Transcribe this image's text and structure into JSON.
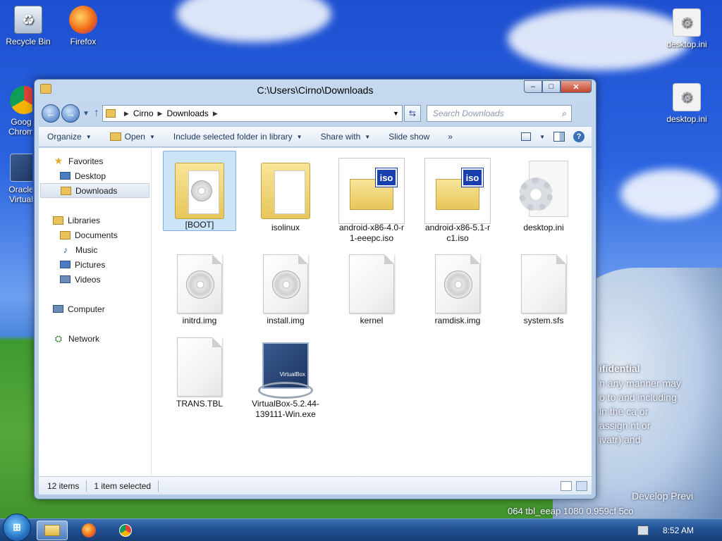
{
  "desktop": {
    "icons_left": [
      {
        "label": "Recycle Bin",
        "icon": "recycle-bin-icon"
      },
      {
        "label": "Firefox",
        "icon": "firefox-icon"
      },
      {
        "label": "Goog Chrom",
        "icon": "chrome-icon"
      },
      {
        "label": "Oracle Virtual",
        "icon": "virtualbox-icon"
      }
    ],
    "icons_right": [
      {
        "label": "desktop.ini",
        "icon": "settings-file-icon"
      },
      {
        "label": "desktop.ini",
        "icon": "settings-file-icon"
      }
    ],
    "wallpaper_text": [
      "ifidential",
      "n any manner may",
      "o to and including",
      "in the ca    or",
      "assign   nt or",
      "    ivatr) and",
      "Develop   Previ",
      "064 tbl_eeap 1080    0.959cf   5co"
    ]
  },
  "window": {
    "title": "C:\\Users\\Cirno\\Downloads",
    "controls": {
      "minimize": "–",
      "maximize": "□",
      "close": "✕"
    },
    "breadcrumb": [
      "Cirno",
      "Downloads"
    ],
    "search_placeholder": "Search Downloads",
    "toolbar": {
      "organize": "Organize",
      "open": "Open",
      "include": "Include selected folder in library",
      "share": "Share with",
      "slideshow": "Slide show",
      "more": "»"
    },
    "nav": {
      "favorites": "Favorites",
      "desktop": "Desktop",
      "downloads": "Downloads",
      "libraries": "Libraries",
      "documents": "Documents",
      "music": "Music",
      "pictures": "Pictures",
      "videos": "Videos",
      "computer": "Computer",
      "network": "Network"
    },
    "files": [
      {
        "name": "[BOOT]",
        "type": "folder-disc",
        "selected": true
      },
      {
        "name": "isolinux",
        "type": "folder"
      },
      {
        "name": "android-x86-4.0-r1-eeepc.iso",
        "label_lines": [
          "android-x86-4.0-r",
          "1-eeepc.iso"
        ],
        "type": "iso"
      },
      {
        "name": "android-x86-5.1-rc1.iso",
        "label_lines": [
          "android-x86-5.1-r",
          "c1.iso"
        ],
        "type": "iso"
      },
      {
        "name": "desktop.ini",
        "type": "config"
      },
      {
        "name": "initrd.img",
        "type": "disc-image"
      },
      {
        "name": "install.img",
        "type": "disc-image"
      },
      {
        "name": "kernel",
        "type": "blank"
      },
      {
        "name": "ramdisk.img",
        "type": "disc-image"
      },
      {
        "name": "system.sfs",
        "type": "blank"
      },
      {
        "name": "TRANS.TBL",
        "type": "blank"
      },
      {
        "name": "VirtualBox-5.2.44-139111-Win.exe",
        "label_lines": [
          "VirtualBox-5.2.44-",
          "139111-Win.exe"
        ],
        "type": "installer"
      }
    ],
    "status": {
      "count": "12 items",
      "selected": "1 item selected"
    }
  },
  "taskbar": {
    "start_label": "⊞",
    "clock": "8:52 AM"
  },
  "colors": {
    "accent": "#3a6fb8",
    "selection": "#cce4f7",
    "taskbar": "#1f4e8f"
  }
}
